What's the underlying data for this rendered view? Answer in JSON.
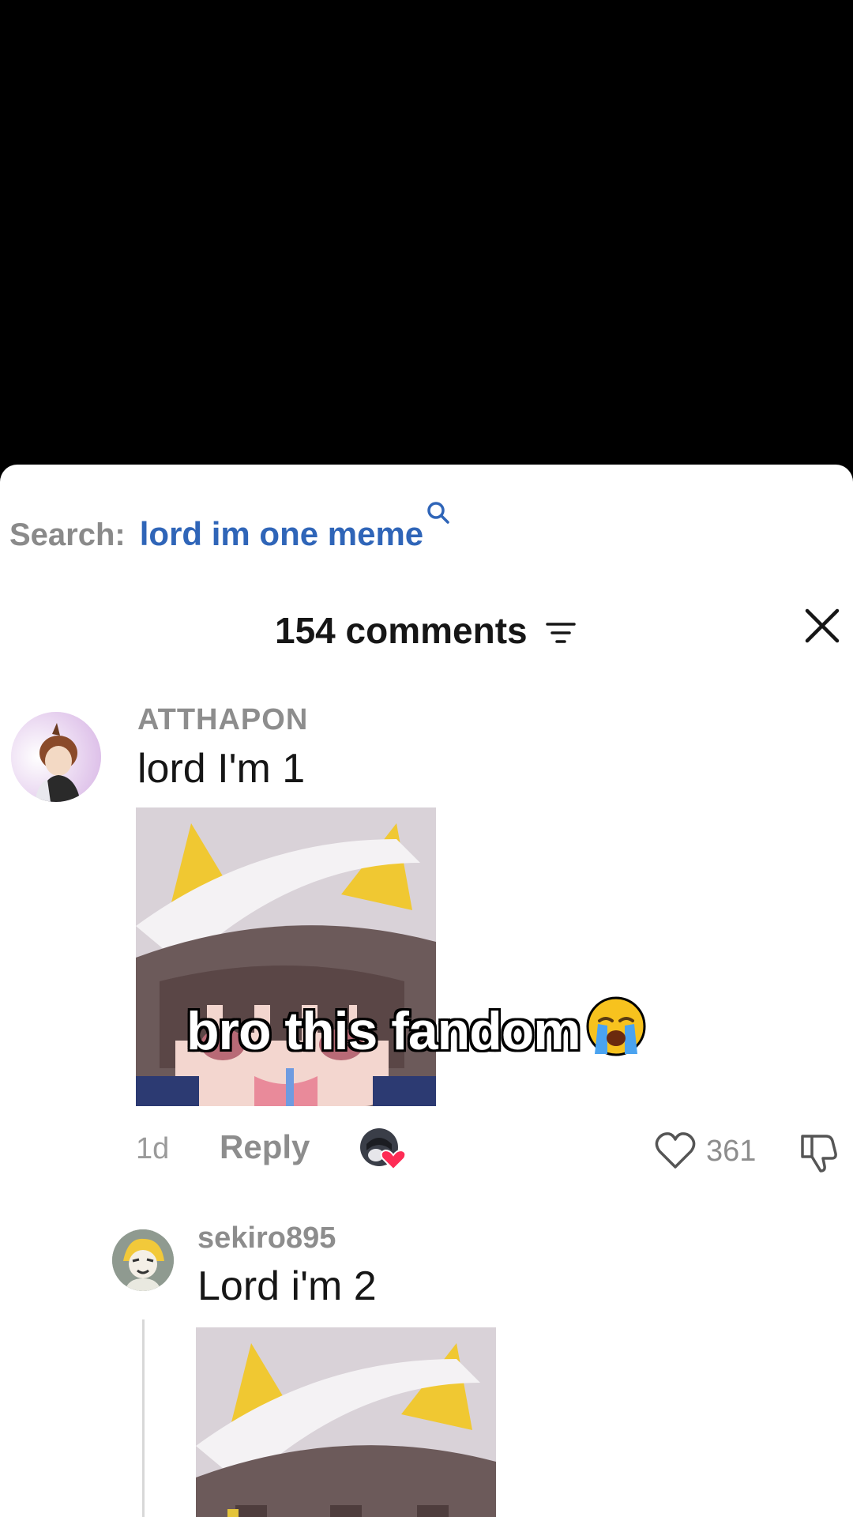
{
  "search": {
    "prefix": "Search:",
    "query": "lord im one meme"
  },
  "comments": {
    "count_label": "154 comments",
    "items": [
      {
        "username": "ATTHAPON",
        "text": "lord I'm 1",
        "time": "1d",
        "reply_label": "Reply",
        "like_count": "361"
      },
      {
        "username": "sekiro895",
        "text": "Lord i'm 2"
      }
    ]
  },
  "video": {
    "caption": "bro this fandom"
  },
  "colors": {
    "link": "#2f65b8",
    "muted": "#8d8d8d",
    "text": "#161616",
    "like_badge": "#fe2c55"
  }
}
